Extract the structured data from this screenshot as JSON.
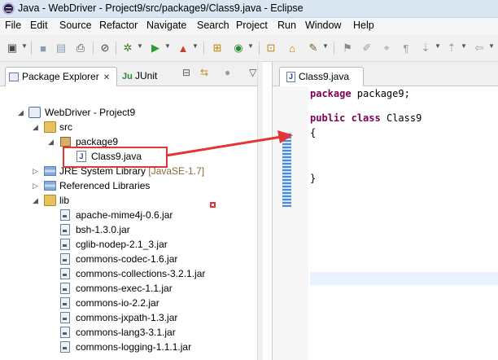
{
  "window": {
    "title": "Java - WebDriver - Project9/src/package9/Class9.java - Eclipse"
  },
  "menu": [
    "File",
    "Edit",
    "Source",
    "Refactor",
    "Navigate",
    "Search",
    "Project",
    "Run",
    "Window",
    "Help"
  ],
  "left_panel": {
    "tabs": [
      {
        "label": "Package Explorer",
        "icon": "package-explorer-icon"
      },
      {
        "label": "JUnit",
        "icon": "junit-icon"
      }
    ],
    "close_glyph": "✕"
  },
  "tree": {
    "project": "WebDriver - Project9",
    "src": "src",
    "package": "package9",
    "file": "Class9.java",
    "jre": "JRE System Library",
    "jre_suffix": "[JavaSE-1.7]",
    "referenced": "Referenced Libraries",
    "lib": "lib",
    "jars": [
      "apache-mime4j-0.6.jar",
      "bsh-1.3.0.jar",
      "cglib-nodep-2.1_3.jar",
      "commons-codec-1.6.jar",
      "commons-collections-3.2.1.jar",
      "commons-exec-1.1.jar",
      "commons-io-2.2.jar",
      "commons-jxpath-1.3.jar",
      "commons-lang3-3.1.jar",
      "commons-logging-1.1.1.jar"
    ]
  },
  "editor": {
    "tab_label": "Class9.java",
    "lines": {
      "package_kw": "package",
      "package_rest": " package9;",
      "public_kw": "public",
      "class_kw": "class",
      "class_name": " Class9",
      "open_brace": "{",
      "close_brace": "}"
    }
  },
  "colors": {
    "keyword": "#7f0055",
    "annotation_red": "#e23636"
  }
}
